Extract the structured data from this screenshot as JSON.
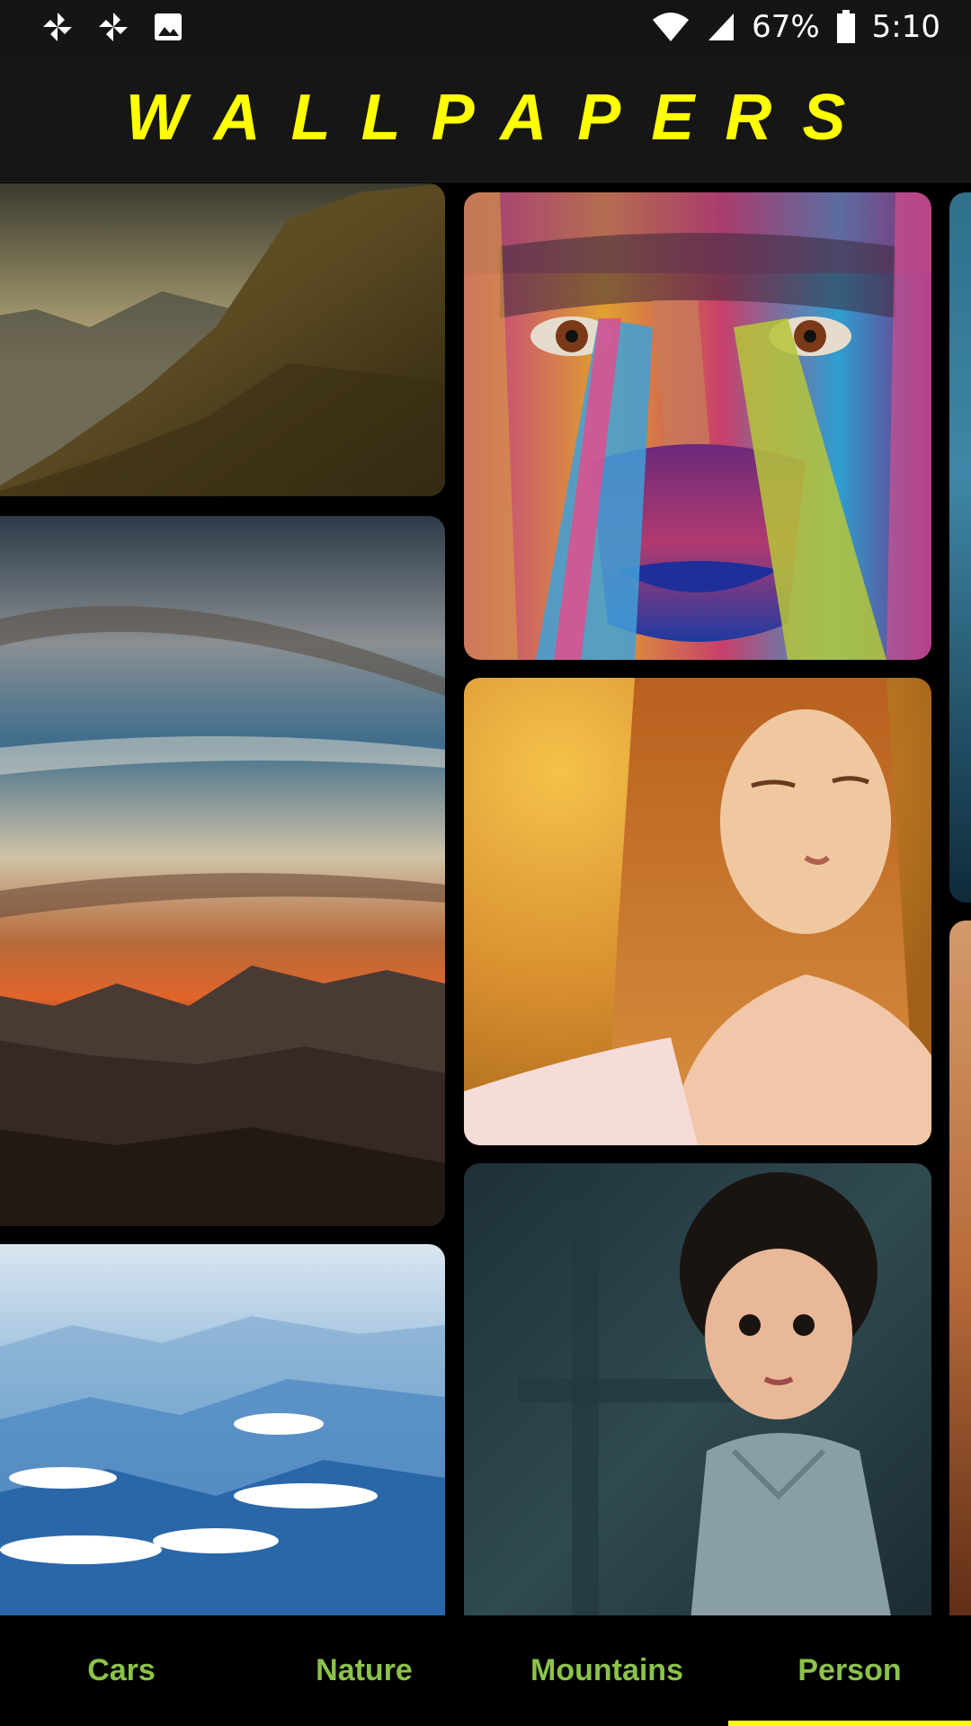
{
  "status_bar": {
    "left_icons": [
      "pinwheel-icon",
      "pinwheel-icon",
      "image-icon"
    ],
    "battery_percent": "67%",
    "time": "5:10",
    "right_icons": [
      "wifi-icon",
      "cell-signal-icon",
      "battery-icon"
    ]
  },
  "header": {
    "title": "WALLPAPERS",
    "title_color": "#FFFF00"
  },
  "grid": {
    "tiles": [
      {
        "name": "mountain-slope-wallpaper",
        "subject": "mountain"
      },
      {
        "name": "sunset-sky-wallpaper",
        "subject": "sky"
      },
      {
        "name": "blue-mountains-clouds-wallpaper",
        "subject": "mountains"
      },
      {
        "name": "painted-face-wallpaper",
        "subject": "person"
      },
      {
        "name": "woman-portrait-wallpaper",
        "subject": "person"
      },
      {
        "name": "child-portrait-wallpaper",
        "subject": "person"
      }
    ]
  },
  "tabs": {
    "items": [
      {
        "label": "Cars",
        "selected": false
      },
      {
        "label": "Nature",
        "selected": false
      },
      {
        "label": "Mountains",
        "selected": false
      },
      {
        "label": "Person",
        "selected": true
      }
    ],
    "label_color": "#8BC34A",
    "indicator_color": "#FFFF00"
  }
}
